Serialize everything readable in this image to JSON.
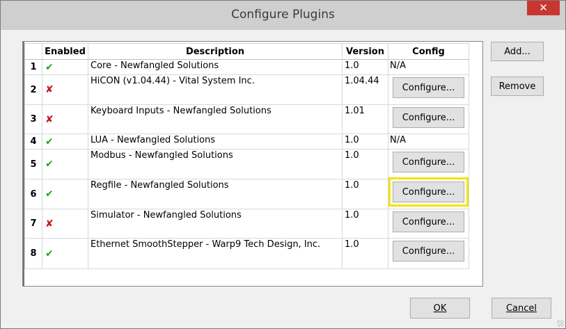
{
  "window": {
    "title": "Configure Plugins",
    "close_glyph": "✕"
  },
  "grid": {
    "columns": [
      "",
      "Enabled",
      "Description",
      "Version",
      "Config"
    ],
    "rows": [
      {
        "num": "1",
        "enabled": true,
        "description": "Core - Newfangled Solutions",
        "version": "1.0",
        "config": "N/A",
        "has_button": false
      },
      {
        "num": "2",
        "enabled": false,
        "description": "HiCON (v1.04.44) - Vital System Inc.",
        "version": "1.04.44",
        "config": "Configure...",
        "has_button": true
      },
      {
        "num": "3",
        "enabled": false,
        "description": "Keyboard Inputs - Newfangled Solutions",
        "version": "1.01",
        "config": "Configure...",
        "has_button": true
      },
      {
        "num": "4",
        "enabled": true,
        "description": "LUA - Newfangled Solutions",
        "version": "1.0",
        "config": "N/A",
        "has_button": false
      },
      {
        "num": "5",
        "enabled": true,
        "description": "Modbus - Newfangled Solutions",
        "version": "1.0",
        "config": "Configure...",
        "has_button": true
      },
      {
        "num": "6",
        "enabled": true,
        "description": "Regfile - Newfangled Solutions",
        "version": "1.0",
        "config": "Configure...",
        "has_button": true,
        "highlighted": true
      },
      {
        "num": "7",
        "enabled": false,
        "description": "Simulator - Newfangled Solutions",
        "version": "1.0",
        "config": "Configure...",
        "has_button": true
      },
      {
        "num": "8",
        "enabled": true,
        "description": "Ethernet SmoothStepper - Warp9 Tech Design, Inc.",
        "version": "1.0",
        "config": "Configure...",
        "has_button": true
      }
    ],
    "enabled_glyph": "✔",
    "disabled_glyph": "✘"
  },
  "side_buttons": {
    "add_label": "Add...",
    "remove_label": "Remove"
  },
  "footer": {
    "ok_label": "OK",
    "cancel_label": "Cancel"
  },
  "colors": {
    "enabled": "#1aa51a",
    "disabled": "#c81414",
    "highlight": "#f5e200",
    "close": "#c7372f"
  }
}
